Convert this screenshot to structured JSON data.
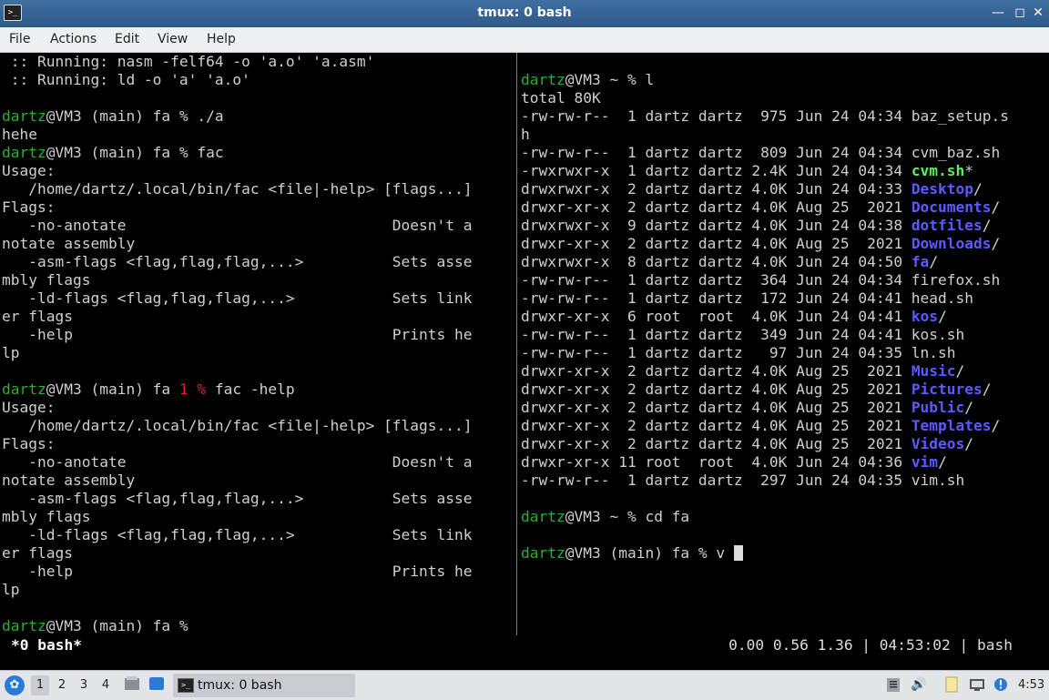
{
  "window": {
    "title": "tmux: 0 bash",
    "icon": "terminal-icon"
  },
  "menubar": {
    "items": [
      "File",
      "Actions",
      "Edit",
      "View",
      "Help"
    ]
  },
  "left_pane": [
    [
      {
        "t": " :: Running: nasm -felf64 -o 'a.o' 'a.asm'"
      }
    ],
    [
      {
        "t": " :: Running: ld -o 'a' 'a.o'"
      }
    ],
    [
      {
        "t": ""
      }
    ],
    [
      {
        "t": "dartz",
        "c": "g"
      },
      {
        "t": "@VM3 (main) fa % ./a"
      }
    ],
    [
      {
        "t": "hehe"
      }
    ],
    [
      {
        "t": "dartz",
        "c": "g"
      },
      {
        "t": "@VM3 (main) fa % fac"
      }
    ],
    [
      {
        "t": "Usage:"
      }
    ],
    [
      {
        "t": "   /home/dartz/.local/bin/fac <file|-help> [flags...]"
      }
    ],
    [
      {
        "t": "Flags:"
      }
    ],
    [
      {
        "t": "   -no-anotate                              Doesn't a"
      }
    ],
    [
      {
        "t": "notate assembly"
      }
    ],
    [
      {
        "t": "   -asm-flags <flag,flag,flag,...>          Sets asse"
      }
    ],
    [
      {
        "t": "mbly flags"
      }
    ],
    [
      {
        "t": "   -ld-flags <flag,flag,flag,...>           Sets link"
      }
    ],
    [
      {
        "t": "er flags"
      }
    ],
    [
      {
        "t": "   -help                                    Prints he"
      }
    ],
    [
      {
        "t": "lp"
      }
    ],
    [
      {
        "t": ""
      }
    ],
    [
      {
        "t": "dartz",
        "c": "g"
      },
      {
        "t": "@VM3 (main) fa "
      },
      {
        "t": "1 %",
        "c": "r"
      },
      {
        "t": " fac -help"
      }
    ],
    [
      {
        "t": "Usage:"
      }
    ],
    [
      {
        "t": "   /home/dartz/.local/bin/fac <file|-help> [flags...]"
      }
    ],
    [
      {
        "t": "Flags:"
      }
    ],
    [
      {
        "t": "   -no-anotate                              Doesn't a"
      }
    ],
    [
      {
        "t": "notate assembly"
      }
    ],
    [
      {
        "t": "   -asm-flags <flag,flag,flag,...>          Sets asse"
      }
    ],
    [
      {
        "t": "mbly flags"
      }
    ],
    [
      {
        "t": "   -ld-flags <flag,flag,flag,...>           Sets link"
      }
    ],
    [
      {
        "t": "er flags"
      }
    ],
    [
      {
        "t": "   -help                                    Prints he"
      }
    ],
    [
      {
        "t": "lp"
      }
    ],
    [
      {
        "t": ""
      }
    ],
    [
      {
        "t": "dartz",
        "c": "g"
      },
      {
        "t": "@VM3 (main) fa %"
      }
    ]
  ],
  "right_pane": [
    [
      {
        "t": ""
      }
    ],
    [
      {
        "t": "dartz",
        "c": "g"
      },
      {
        "t": "@VM3 ~ % l"
      }
    ],
    [
      {
        "t": "total 80K"
      }
    ],
    [
      {
        "t": "-rw-rw-r--  1 dartz dartz  975 Jun 24 04:34 baz_setup.s"
      }
    ],
    [
      {
        "t": "h"
      }
    ],
    [
      {
        "t": "-rw-rw-r--  1 dartz dartz  809 Jun 24 04:34 cvm_baz.sh"
      }
    ],
    [
      {
        "t": "-rwxrwxr-x  1 dartz dartz 2.4K Jun 24 04:34 "
      },
      {
        "t": "cvm.sh",
        "c": "x"
      },
      {
        "t": "*"
      }
    ],
    [
      {
        "t": "drwxrwxr-x  2 dartz dartz 4.0K Jun 24 04:33 "
      },
      {
        "t": "Desktop",
        "c": "b"
      },
      {
        "t": "/"
      }
    ],
    [
      {
        "t": "drwxr-xr-x  2 dartz dartz 4.0K Aug 25  2021 "
      },
      {
        "t": "Documents",
        "c": "b"
      },
      {
        "t": "/"
      }
    ],
    [
      {
        "t": "drwxrwxr-x  9 dartz dartz 4.0K Jun 24 04:38 "
      },
      {
        "t": "dotfiles",
        "c": "b"
      },
      {
        "t": "/"
      }
    ],
    [
      {
        "t": "drwxr-xr-x  2 dartz dartz 4.0K Aug 25  2021 "
      },
      {
        "t": "Downloads",
        "c": "b"
      },
      {
        "t": "/"
      }
    ],
    [
      {
        "t": "drwxrwxr-x  8 dartz dartz 4.0K Jun 24 04:50 "
      },
      {
        "t": "fa",
        "c": "b"
      },
      {
        "t": "/"
      }
    ],
    [
      {
        "t": "-rw-rw-r--  1 dartz dartz  364 Jun 24 04:34 firefox.sh"
      }
    ],
    [
      {
        "t": "-rw-rw-r--  1 dartz dartz  172 Jun 24 04:41 head.sh"
      }
    ],
    [
      {
        "t": "drwxr-xr-x  6 root  root  4.0K Jun 24 04:41 "
      },
      {
        "t": "kos",
        "c": "b"
      },
      {
        "t": "/"
      }
    ],
    [
      {
        "t": "-rw-rw-r--  1 dartz dartz  349 Jun 24 04:41 kos.sh"
      }
    ],
    [
      {
        "t": "-rw-rw-r--  1 dartz dartz   97 Jun 24 04:35 ln.sh"
      }
    ],
    [
      {
        "t": "drwxr-xr-x  2 dartz dartz 4.0K Aug 25  2021 "
      },
      {
        "t": "Music",
        "c": "b"
      },
      {
        "t": "/"
      }
    ],
    [
      {
        "t": "drwxr-xr-x  2 dartz dartz 4.0K Aug 25  2021 "
      },
      {
        "t": "Pictures",
        "c": "b"
      },
      {
        "t": "/"
      }
    ],
    [
      {
        "t": "drwxr-xr-x  2 dartz dartz 4.0K Aug 25  2021 "
      },
      {
        "t": "Public",
        "c": "b"
      },
      {
        "t": "/"
      }
    ],
    [
      {
        "t": "drwxr-xr-x  2 dartz dartz 4.0K Aug 25  2021 "
      },
      {
        "t": "Templates",
        "c": "b"
      },
      {
        "t": "/"
      }
    ],
    [
      {
        "t": "drwxr-xr-x  2 dartz dartz 4.0K Aug 25  2021 "
      },
      {
        "t": "Videos",
        "c": "b"
      },
      {
        "t": "/"
      }
    ],
    [
      {
        "t": "drwxr-xr-x 11 root  root  4.0K Jun 24 04:36 "
      },
      {
        "t": "vim",
        "c": "b"
      },
      {
        "t": "/"
      }
    ],
    [
      {
        "t": "-rw-rw-r--  1 dartz dartz  297 Jun 24 04:35 vim.sh"
      }
    ],
    [
      {
        "t": ""
      }
    ],
    [
      {
        "t": "dartz",
        "c": "g"
      },
      {
        "t": "@VM3 ~ % cd fa"
      }
    ],
    [
      {
        "t": ""
      }
    ],
    [
      {
        "t": "dartz",
        "c": "g"
      },
      {
        "t": "@VM3 (main) fa % v "
      },
      {
        "cursor": true
      }
    ]
  ],
  "statusbar": {
    "left": "*0 bash*",
    "right": "0.00 0.56 1.36 | 04:53:02 | bash"
  },
  "taskbar": {
    "workspaces": [
      "1",
      "2",
      "3",
      "4"
    ],
    "active_workspace": 0,
    "task_label": "tmux: 0 bash",
    "clock": "4:53",
    "colors": {
      "prompt_user": "#2db02d",
      "directory": "#5b5bff",
      "executable": "#5ef05e",
      "error_code": "#dd2222",
      "titlebar": "#3f6ea0"
    }
  }
}
